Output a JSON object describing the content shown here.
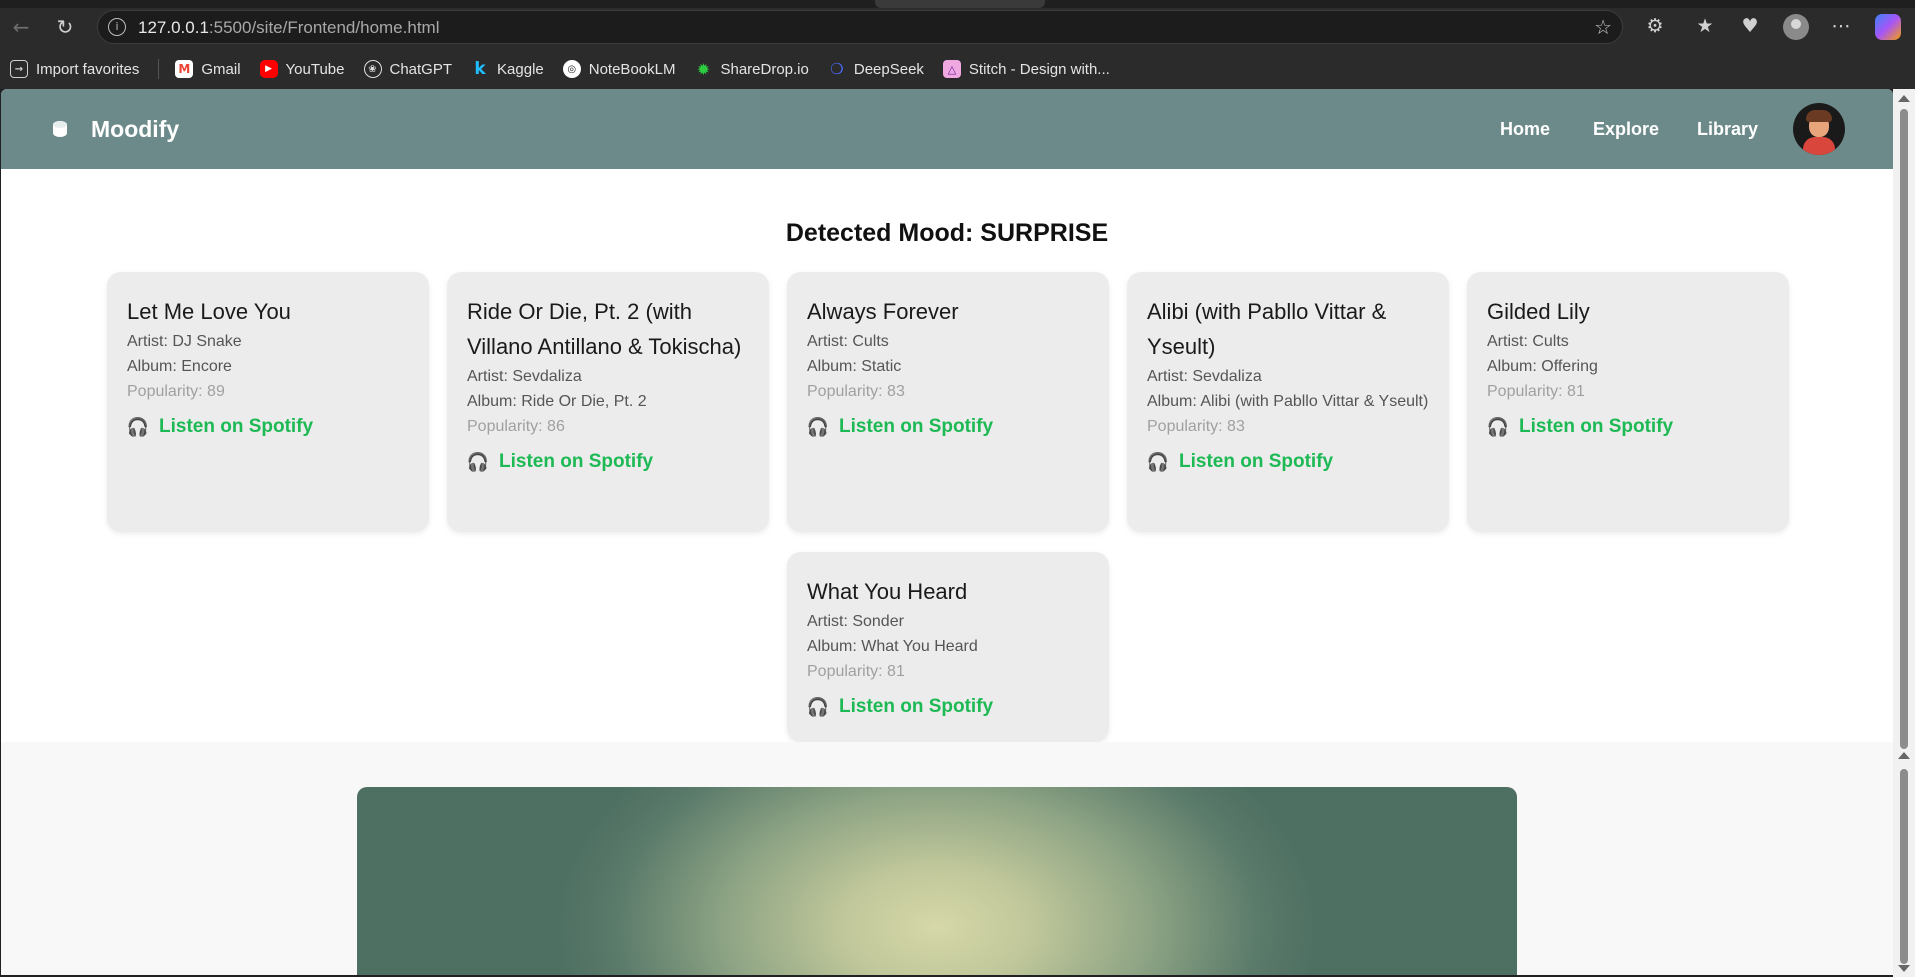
{
  "browser": {
    "url_host": "127.0.0.1",
    "url_rest": ":5500/site/Frontend/home.html",
    "bookmarks": [
      {
        "label": "Import favorites",
        "icon": "import-icon"
      },
      {
        "label": "Gmail",
        "icon": "gmail-icon"
      },
      {
        "label": "YouTube",
        "icon": "youtube-icon"
      },
      {
        "label": "ChatGPT",
        "icon": "chatgpt-icon"
      },
      {
        "label": "Kaggle",
        "icon": "kaggle-icon"
      },
      {
        "label": "NoteBookLM",
        "icon": "notebooklm-icon"
      },
      {
        "label": "ShareDrop.io",
        "icon": "sharedrop-icon"
      },
      {
        "label": "DeepSeek",
        "icon": "deepseek-icon"
      },
      {
        "label": "Stitch - Design with...",
        "icon": "stitch-icon"
      }
    ]
  },
  "site": {
    "title": "Moodify",
    "nav": {
      "home": "Home",
      "explore": "Explore",
      "library": "Library"
    }
  },
  "main": {
    "mood_heading": "Detected Mood: SURPRISE",
    "songs": [
      {
        "title": "Let Me Love You",
        "artist": "Artist: DJ Snake",
        "album": "Album: Encore",
        "popularity": "Popularity: 89",
        "link": "Listen on Spotify"
      },
      {
        "title": "Ride Or Die, Pt. 2 (with Villano Antillano & Tokischa)",
        "artist": "Artist: Sevdaliza",
        "album": "Album: Ride Or Die, Pt. 2",
        "popularity": "Popularity: 86",
        "link": "Listen on Spotify"
      },
      {
        "title": "Always Forever",
        "artist": "Artist: Cults",
        "album": "Album: Static",
        "popularity": "Popularity: 83",
        "link": "Listen on Spotify"
      },
      {
        "title": "Alibi (with Pabllo Vittar & Yseult)",
        "artist": "Artist: Sevdaliza",
        "album": "Album: Alibi (with Pabllo Vittar & Yseult)",
        "popularity": "Popularity: 83",
        "link": "Listen on Spotify"
      },
      {
        "title": "Gilded Lily",
        "artist": "Artist: Cults",
        "album": "Album: Offering",
        "popularity": "Popularity: 81",
        "link": "Listen on Spotify"
      },
      {
        "title": "What You Heard",
        "artist": "Artist: Sonder",
        "album": "Album: What You Heard",
        "popularity": "Popularity: 81",
        "link": "Listen on Spotify"
      }
    ]
  },
  "colors": {
    "navbar": "#6d8a8a",
    "spotify_green": "#1db954",
    "card_bg": "#ececec"
  }
}
